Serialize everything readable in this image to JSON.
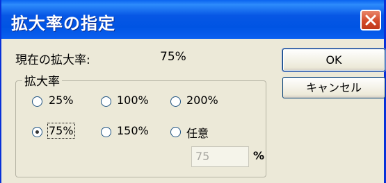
{
  "dialog": {
    "title": "拡大率の指定",
    "current_label": "現在の拡大率:",
    "current_value": "75%",
    "group_label": "拡大率",
    "options": [
      {
        "label": "25%",
        "checked": false
      },
      {
        "label": "100%",
        "checked": false
      },
      {
        "label": "200%",
        "checked": false
      },
      {
        "label": "75%",
        "checked": true
      },
      {
        "label": "150%",
        "checked": false
      },
      {
        "label": "任意",
        "checked": false
      }
    ],
    "custom_value": "75",
    "custom_unit": "%",
    "ok_label": "OK",
    "cancel_label": "キャンセル"
  },
  "colors": {
    "titlebar": "#0054e3",
    "dialog_bg": "#ece9d8",
    "close_button": "#d34b2b"
  },
  "icons": {
    "close": "close-icon"
  }
}
